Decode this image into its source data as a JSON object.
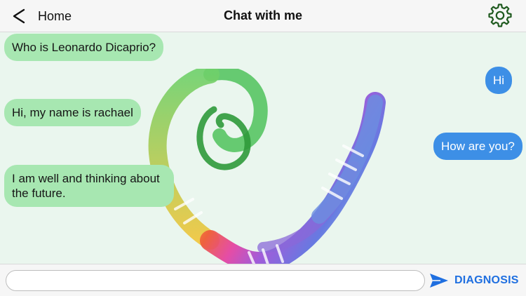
{
  "nav": {
    "back_label": "Home",
    "title": "Chat with me",
    "back_icon": "chevron-left-icon",
    "settings_icon": "gear-icon"
  },
  "messages": [
    {
      "side": "in",
      "text": "Who is Leonardo Dicaprio?"
    },
    {
      "side": "out",
      "text": "Hi"
    },
    {
      "side": "in",
      "text": "Hi, my name is rachael"
    },
    {
      "side": "out",
      "text": "How are you?"
    },
    {
      "side": "in",
      "text": "I am well and thinking about the future."
    }
  ],
  "composer": {
    "value": "",
    "placeholder": "",
    "send_icon": "send-arrow-icon",
    "action_label": "DIAGNOSIS"
  },
  "colors": {
    "incoming_bubble": "#a7e7b1",
    "outgoing_bubble": "#3d8fe6",
    "background": "#eaf6ee",
    "accent": "#1f6fe0"
  }
}
